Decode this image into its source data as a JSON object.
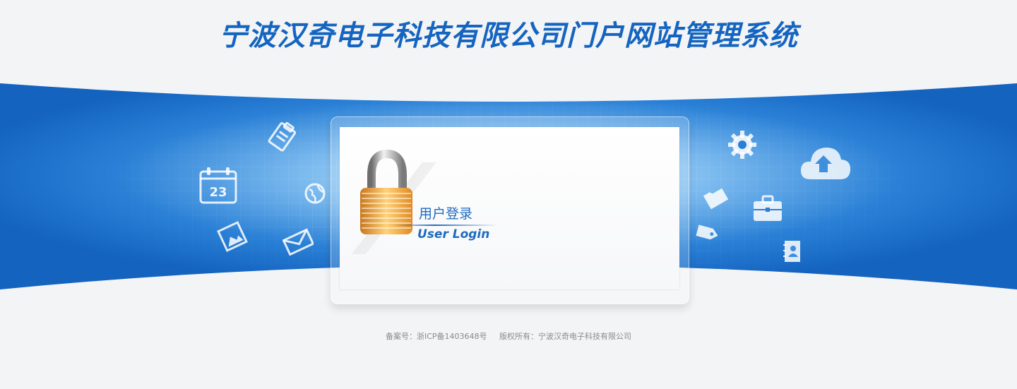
{
  "header": {
    "title": "宁波汉奇电子科技有限公司门户网站管理系统"
  },
  "login": {
    "title_cn": "用户登录",
    "title_en": "User Login"
  },
  "calendar": {
    "day": "23"
  },
  "footer": {
    "icp": "备案号：浙ICP备1403648号",
    "copyright": "版权所有：宁波汉奇电子科技有限公司"
  },
  "colors": {
    "brand_blue": "#1565c0",
    "band_blue": "#1a6cc8",
    "footer_text": "#8a8a8a"
  },
  "decor_icons": [
    "clipboard-icon",
    "calendar-icon",
    "globe-icon",
    "photo-icon",
    "mail-icon",
    "gear-icon",
    "cloud-upload-icon",
    "folder-icon",
    "briefcase-icon",
    "tag-icon",
    "contacts-icon",
    "padlock-icon"
  ]
}
